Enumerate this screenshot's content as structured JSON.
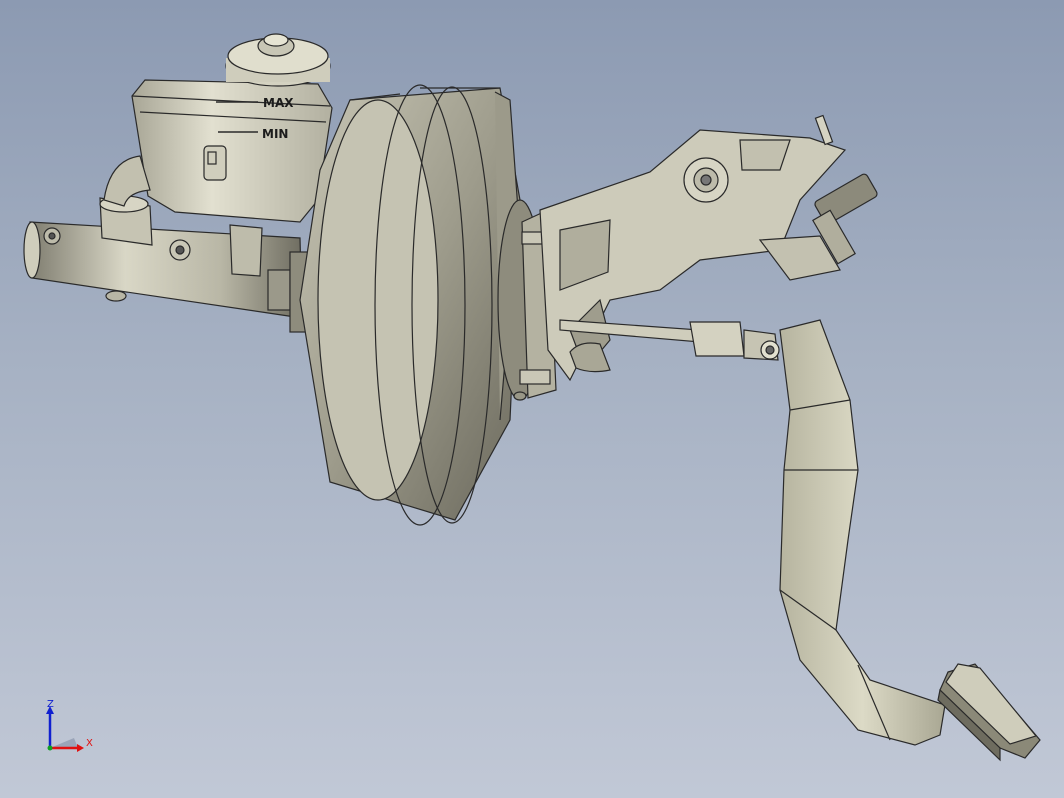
{
  "reservoir": {
    "max_label": "MAX",
    "min_label": "MIN"
  },
  "triad": {
    "z_label": "Z",
    "x_label": "X"
  },
  "colors": {
    "background_top": "#8c9ab2",
    "background_bottom": "#c1c8d6",
    "part_fill": "#d6d4c3",
    "part_edge": "#2a2a2a",
    "axis_x": "#e01010",
    "axis_z": "#1020d0"
  }
}
